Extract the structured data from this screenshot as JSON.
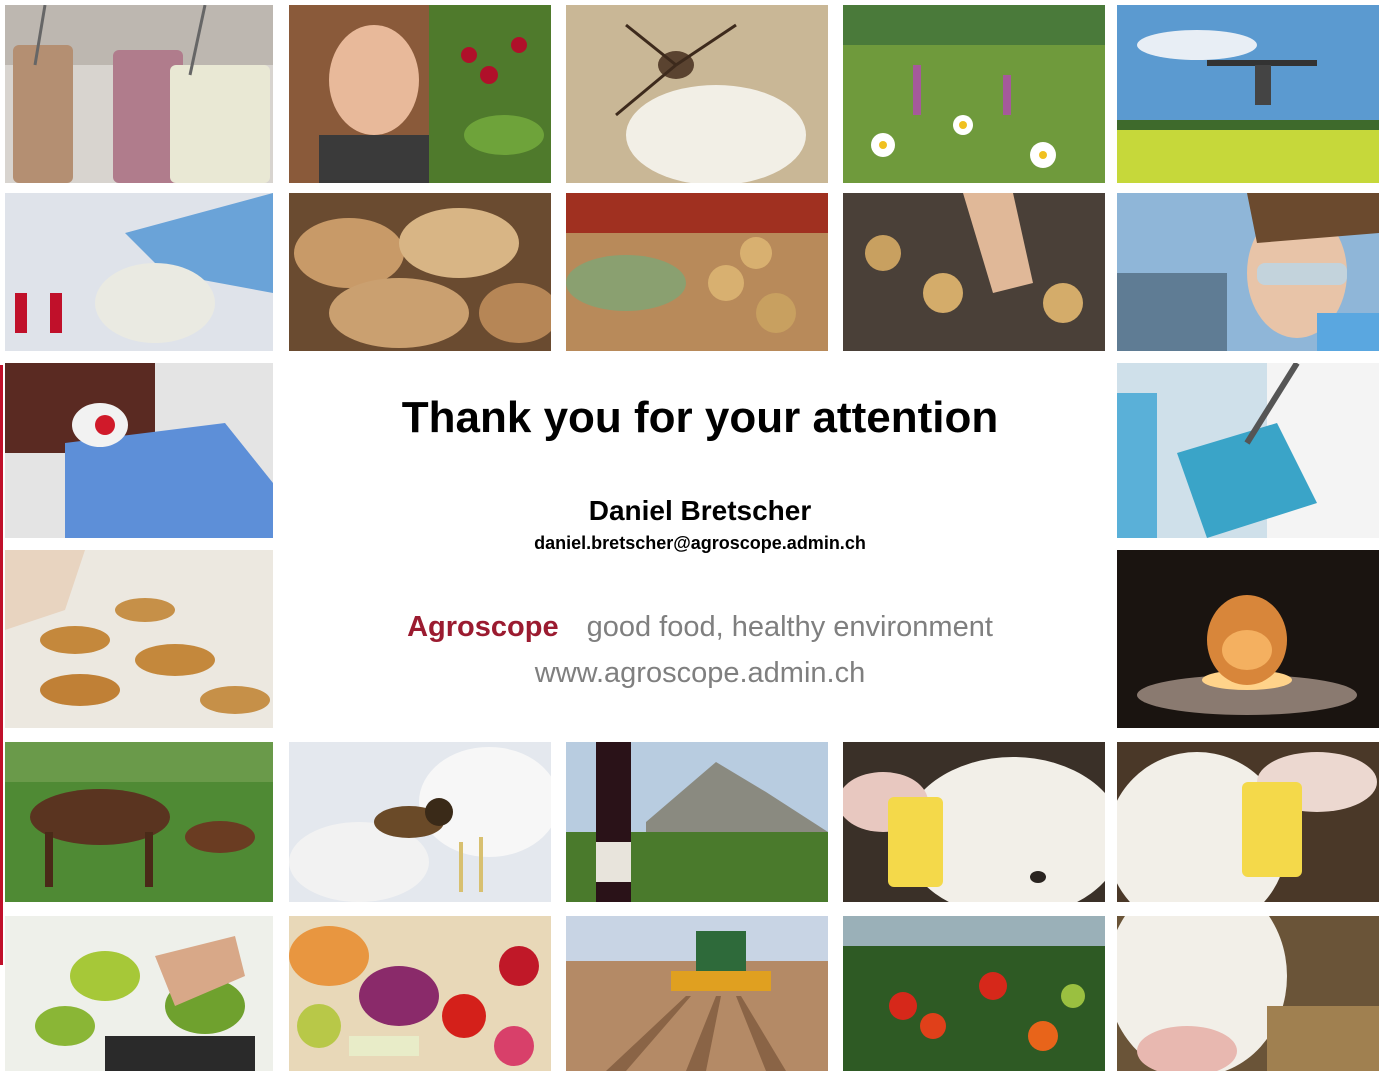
{
  "slide": {
    "title": "Thank you for your attention",
    "presenter_name": "Daniel Bretscher",
    "presenter_email": "daniel.bretscher@agroscope.admin.ch",
    "brand": "Agroscope",
    "slogan": "good food, healthy environment",
    "website": "www.agroscope.admin.ch"
  },
  "colors": {
    "brand_red": "#9b1b30",
    "slogan_gray": "#7f7f7f"
  }
}
